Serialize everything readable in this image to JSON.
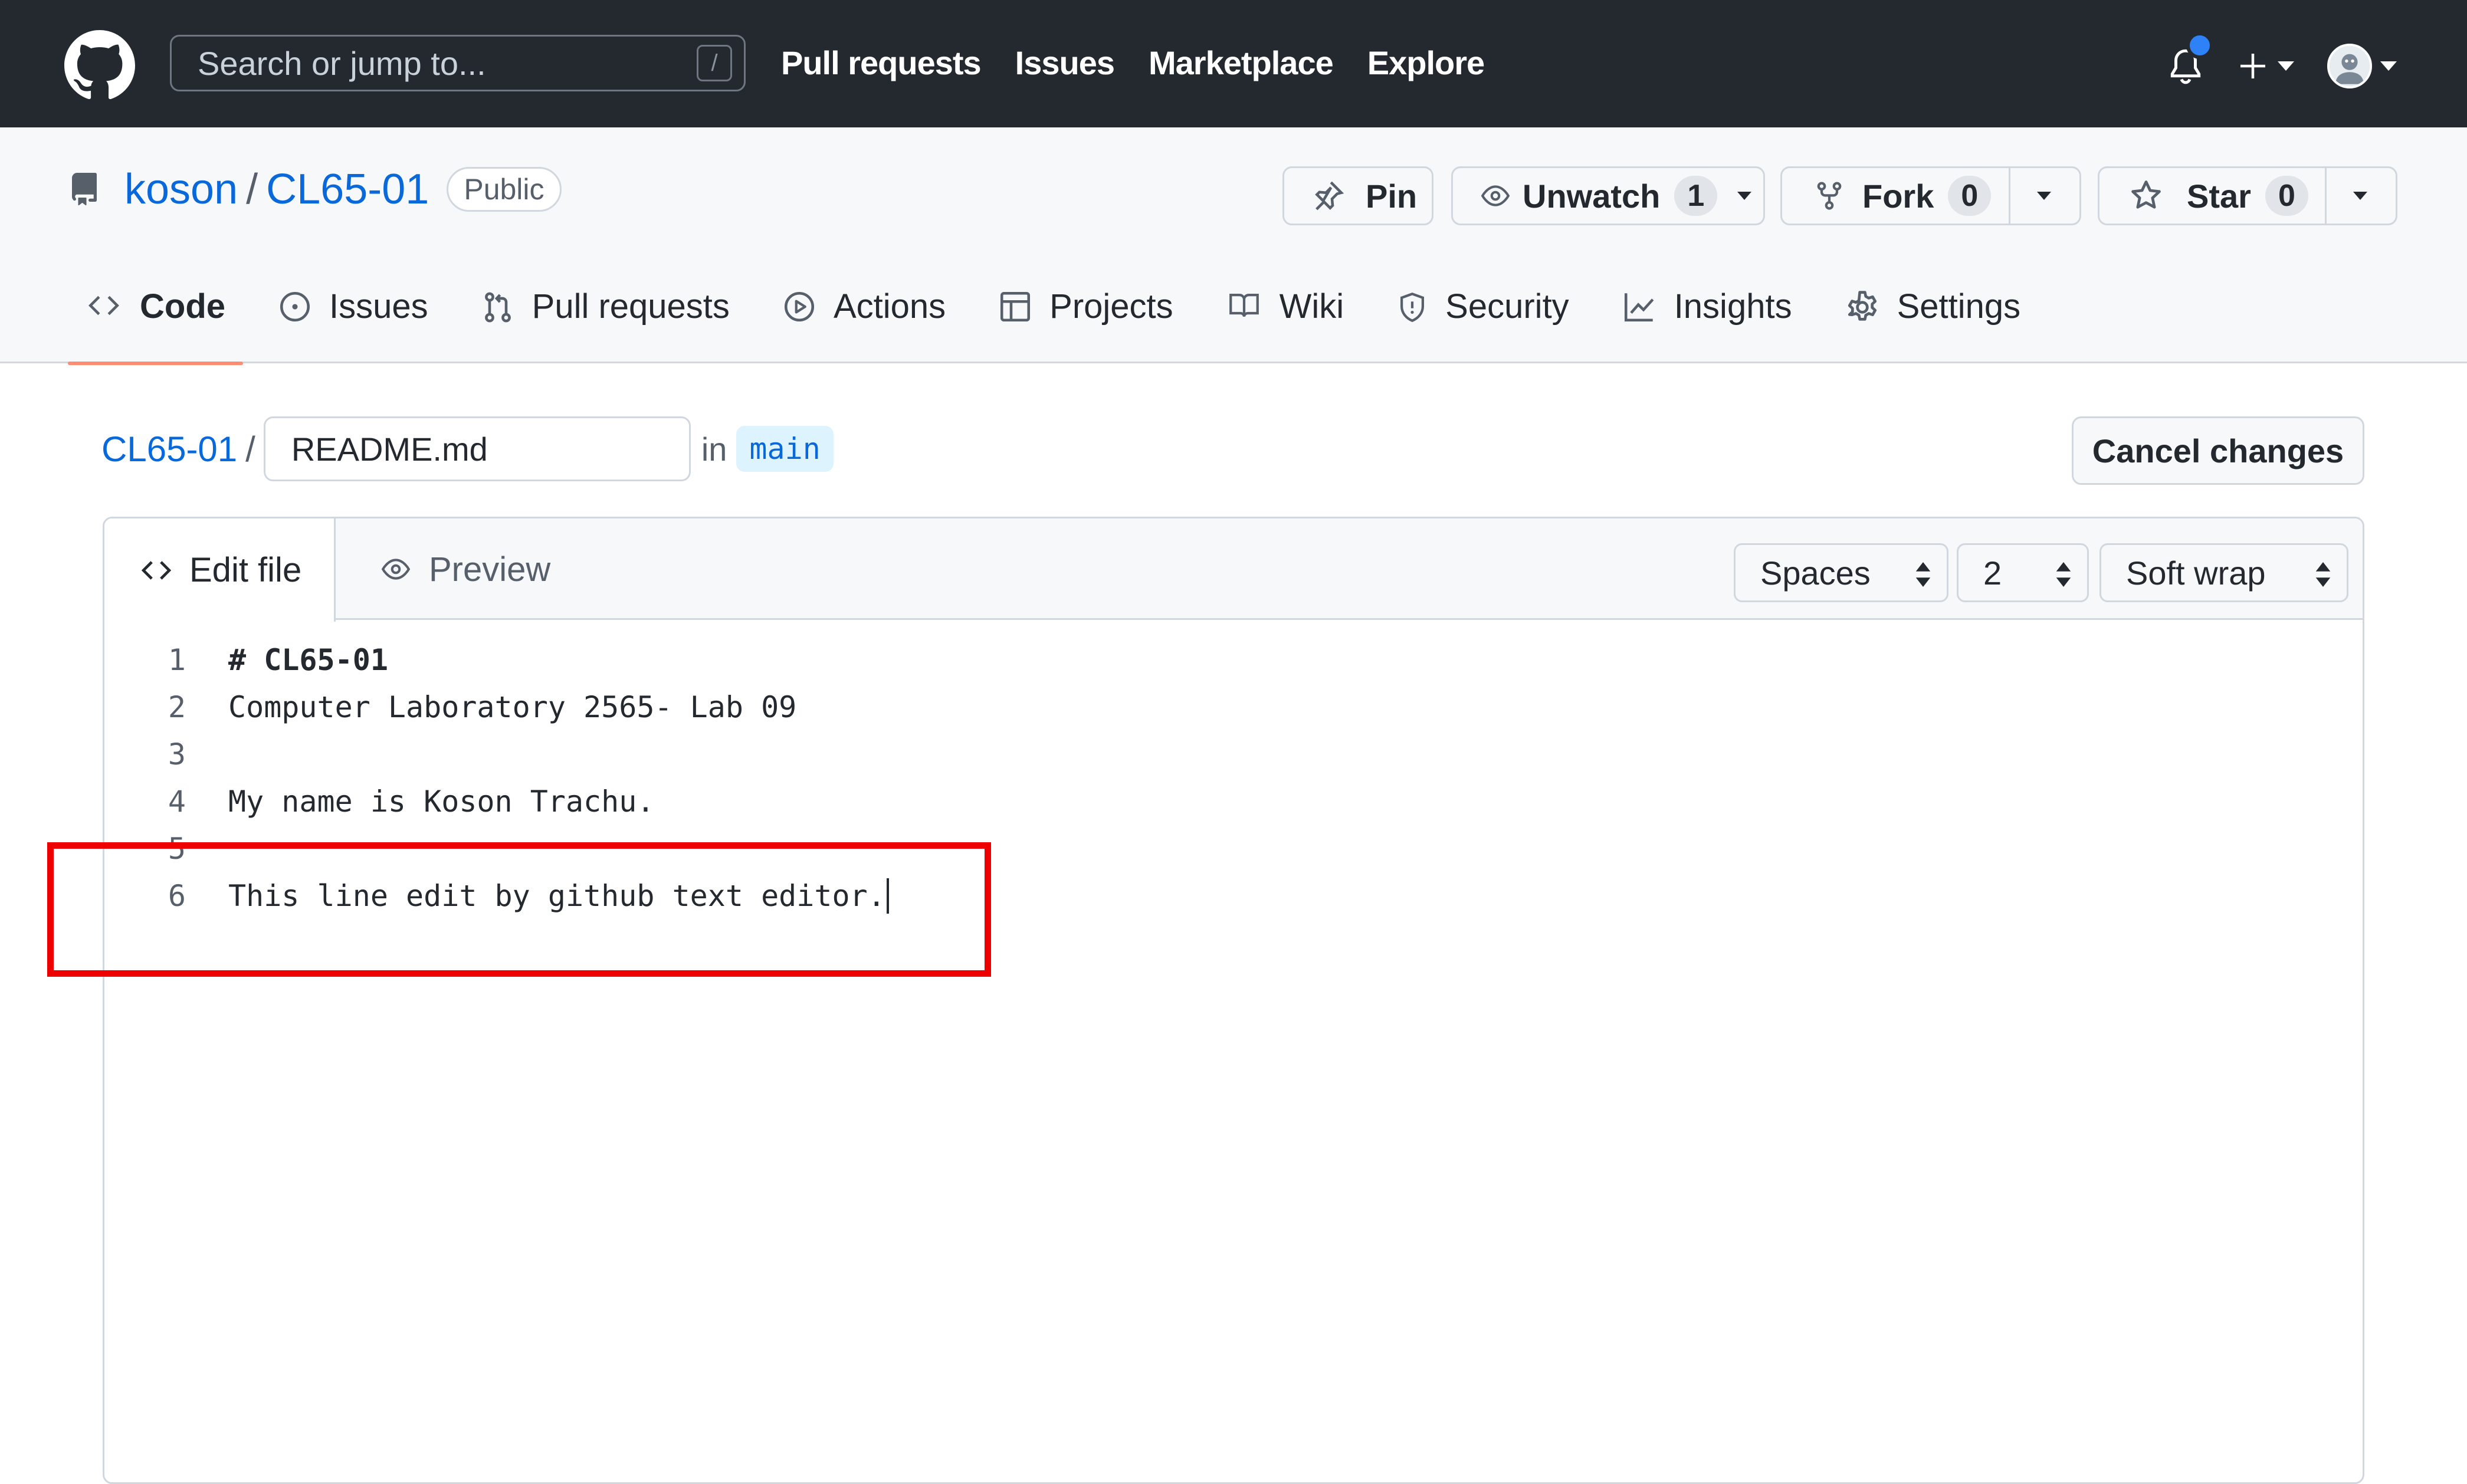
{
  "header": {
    "search_placeholder": "Search or jump to...",
    "search_key": "/",
    "nav": [
      "Pull requests",
      "Issues",
      "Marketplace",
      "Explore"
    ],
    "plus_label": "+"
  },
  "repo": {
    "owner": "koson",
    "separator": "/",
    "name": "CL65-01",
    "visibility": "Public",
    "pin_label": "Pin",
    "unwatch_label": "Unwatch",
    "watch_count": "1",
    "fork_label": "Fork",
    "fork_count": "0",
    "star_label": "Star",
    "star_count": "0"
  },
  "tabs": [
    {
      "label": "Code",
      "icon": "code-icon"
    },
    {
      "label": "Issues",
      "icon": "issue-icon"
    },
    {
      "label": "Pull requests",
      "icon": "pull-request-icon"
    },
    {
      "label": "Actions",
      "icon": "play-icon"
    },
    {
      "label": "Projects",
      "icon": "table-icon"
    },
    {
      "label": "Wiki",
      "icon": "book-icon"
    },
    {
      "label": "Security",
      "icon": "shield-icon"
    },
    {
      "label": "Insights",
      "icon": "graph-icon"
    },
    {
      "label": "Settings",
      "icon": "gear-icon"
    }
  ],
  "editor": {
    "breadcrumb_repo": "CL65-01",
    "breadcrumb_sep": "/",
    "filename": "README.md",
    "in_label": "in",
    "branch": "main",
    "cancel_label": "Cancel changes",
    "edit_tab": "Edit file",
    "preview_tab": "Preview",
    "indent_mode": "Spaces",
    "indent_size": "2",
    "wrap_mode": "Soft wrap",
    "lines": [
      {
        "num": "1",
        "text": "# CL65-01"
      },
      {
        "num": "2",
        "text": "Computer Laboratory 2565- Lab 09"
      },
      {
        "num": "3",
        "text": ""
      },
      {
        "num": "4",
        "text": "My name is Koson Trachu."
      },
      {
        "num": "5",
        "text": ""
      },
      {
        "num": "6",
        "text": "This line edit by github text editor."
      }
    ]
  },
  "colors": {
    "header_bg": "#24292f",
    "link": "#0969da",
    "active_tab_underline": "#fd8c73",
    "annotation_box": "#ee0000"
  }
}
